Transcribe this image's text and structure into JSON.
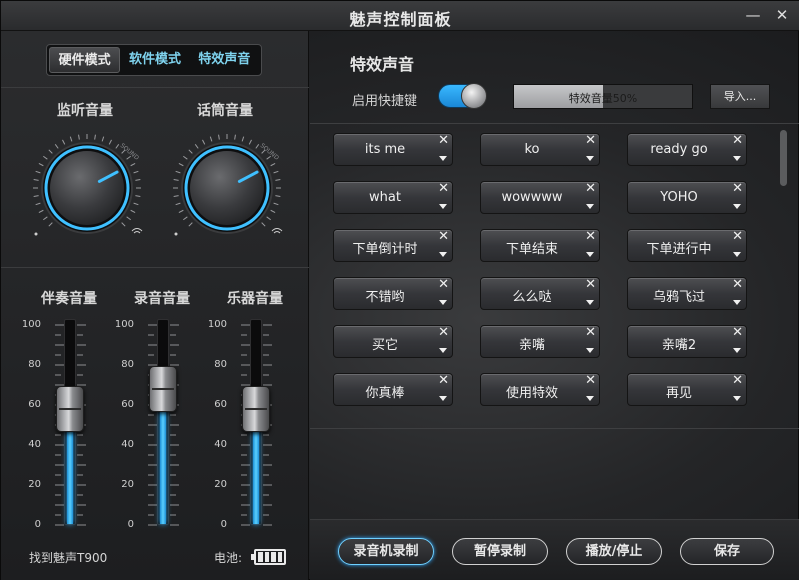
{
  "window": {
    "title": "魅声控制面板",
    "minimize_glyph": "—",
    "close_glyph": "✕"
  },
  "modes": [
    {
      "label": "硬件模式",
      "active": true
    },
    {
      "label": "软件模式",
      "active": false
    },
    {
      "label": "特效声音",
      "active": false
    }
  ],
  "knobs": [
    {
      "label": "监听音量",
      "sound_label": "SOUND",
      "level": 0.73
    },
    {
      "label": "话筒音量",
      "sound_label": "SOUND",
      "level": 0.73
    }
  ],
  "sliders": {
    "scale": [
      "100",
      "80",
      "60",
      "40",
      "20",
      "0"
    ],
    "items": [
      {
        "label": "伴奏音量",
        "value": 58
      },
      {
        "label": "录音音量",
        "value": 68
      },
      {
        "label": "乐器音量",
        "value": 58
      }
    ]
  },
  "status": {
    "device": "找到魅声T900",
    "battery_label": "电池:",
    "battery_level": 1.0
  },
  "effects": {
    "title": "特效声音",
    "hotkey_label": "启用快捷键",
    "hotkey_enabled": true,
    "progress_text": "特效音量50%",
    "progress_value": 0.5,
    "import_label": "导入...",
    "buttons": [
      "its me",
      "ko",
      "ready go",
      "what",
      "wowwww",
      "YOHO",
      "下单倒计时",
      "下单结束",
      "下单进行中",
      "不错哟",
      "么么哒",
      "乌鸦飞过",
      "买它",
      "亲嘴",
      "亲嘴2",
      "你真棒",
      "使用特效",
      "再见"
    ],
    "close_glyph": "✕"
  },
  "actions": [
    {
      "label": "录音机录制",
      "primary": true
    },
    {
      "label": "暂停录制",
      "primary": false
    },
    {
      "label": "播放/停止",
      "primary": false
    },
    {
      "label": "保存",
      "primary": false
    }
  ],
  "colors": {
    "accent": "#3fc0ff",
    "fill": "#37b5ff",
    "background": "#1a1b1d"
  }
}
